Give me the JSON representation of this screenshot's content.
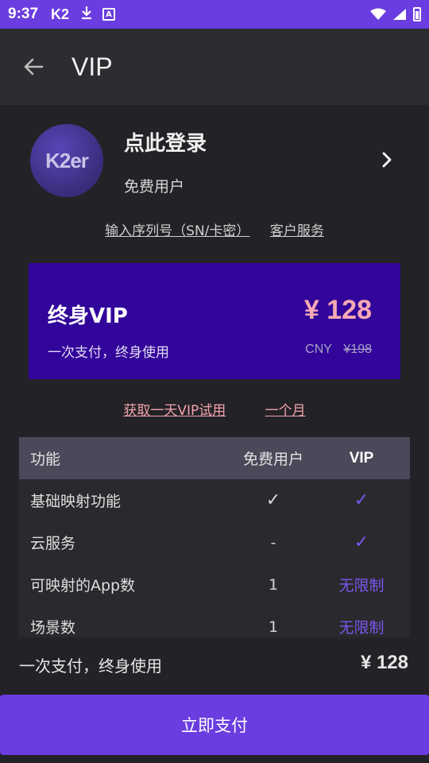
{
  "status_bar": {
    "time": "9:37",
    "app_badge": "K2",
    "download_icon": "download-icon",
    "a_badge": "A"
  },
  "app_bar": {
    "title": "VIP",
    "back_icon": "arrow-left-icon"
  },
  "profile": {
    "avatar_text": "K2er",
    "login_label": "点此登录",
    "user_type": "免费用户"
  },
  "links": {
    "serial": "输入序列号（SN/卡密）",
    "support": "客户服务"
  },
  "vip_card": {
    "name": "终身VIP",
    "description": "一次支付，终身使用",
    "price": "¥ 128",
    "currency": "CNY",
    "old_price": "¥198",
    "background_color": "#33069b",
    "price_color": "#f7a9b4"
  },
  "trial_links": {
    "one_day": "获取一天VIP试用",
    "one_month": "一个月"
  },
  "table": {
    "headers": [
      "功能",
      "免费用户",
      "VIP"
    ],
    "rows": [
      [
        "基础映射功能",
        "✓",
        "✓"
      ],
      [
        "云服务",
        "-",
        "✓"
      ],
      [
        "可映射的App数",
        "1",
        "无限制"
      ],
      [
        "场景数",
        "1",
        "无限制"
      ]
    ]
  },
  "bottom": {
    "total_label": "一次支付，终身使用",
    "total_price": "¥ 128",
    "pay_button": "立即支付",
    "accent_color": "#6a3de0"
  }
}
